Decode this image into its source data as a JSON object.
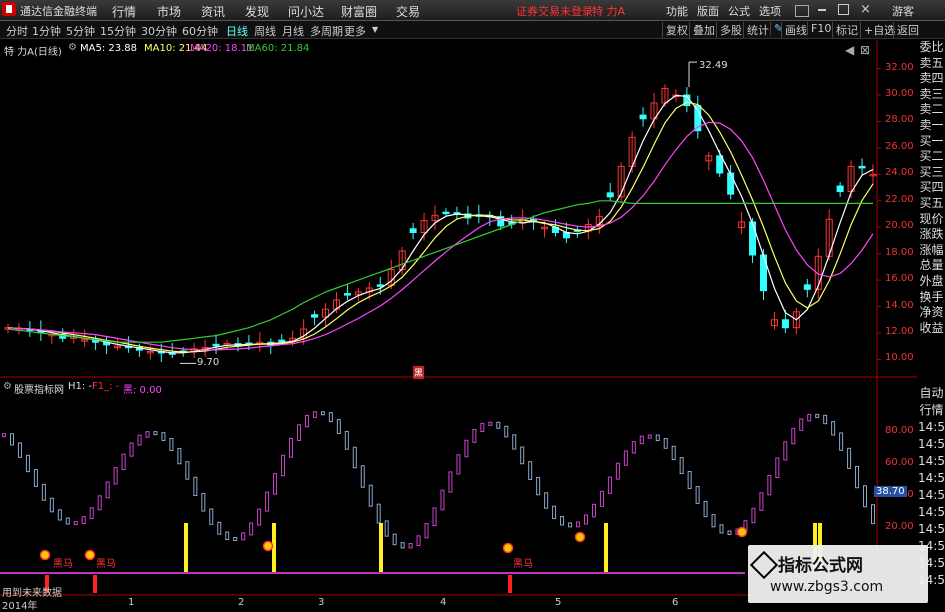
{
  "app": {
    "title": "通达信金融终端",
    "menu": [
      "行情",
      "市场",
      "资讯",
      "发现",
      "问小达",
      "财富圈",
      "交易"
    ],
    "status_text": "证券交易未登录",
    "stock_header": "特 力A",
    "right_menu": [
      "功能",
      "版面",
      "公式",
      "选项"
    ],
    "guest": "游客"
  },
  "toolbar": {
    "periods": [
      "分时",
      "1分钟",
      "5分钟",
      "15分钟",
      "30分钟",
      "60分钟",
      "日线",
      "周线",
      "月线",
      "多周期",
      "更多"
    ],
    "active_period": "日线",
    "right": [
      "复权",
      "叠加",
      "多股",
      "统计",
      "画线",
      "F10",
      "标记",
      "+自选",
      "返回"
    ]
  },
  "main_legend": {
    "stock": "特 力A(日线)",
    "ma5": "MA5: 23.88",
    "ma10": "MA10: 21.44",
    "ma20": "MA20: 18.11",
    "ma60": "MA60: 21.84",
    "colors": {
      "ma5": "#ffffff",
      "ma10": "#ffff66",
      "ma20": "#ff44ff",
      "ma60": "#33cc33"
    }
  },
  "indicator_legend": {
    "name": "股票指标网",
    "h1": "H1: -",
    "f1": "F1_: -",
    "black": "黑: 0.00"
  },
  "price_axis": [
    "32.00",
    "30.00",
    "28.00",
    "26.00",
    "24.00",
    "22.00",
    "20.00",
    "18.00",
    "16.00",
    "14.00",
    "12.00",
    "10.00"
  ],
  "indicator_axis": [
    "80.00",
    "60.00",
    "40.00",
    "20.00"
  ],
  "indicator_current": "38.70",
  "annotations": {
    "high": "32.49",
    "low": "9.70",
    "marker": "黑"
  },
  "horse_labels": [
    "黑马",
    "黑马",
    "黑马"
  ],
  "bottom_note": "用到未来数据",
  "date_axis": [
    "2014年",
    "1",
    "2",
    "3",
    "4",
    "5",
    "6"
  ],
  "side_panel": [
    "委比",
    "卖五",
    "卖四",
    "卖三",
    "卖二",
    "卖一",
    "买一",
    "买二",
    "买三",
    "买四",
    "买五",
    "现价",
    "涨跌",
    "涨幅",
    "总量",
    "外盘",
    "换手",
    "净资",
    "收益"
  ],
  "side_panel2": [
    "自动",
    "行情",
    "14:55",
    "14:55",
    "14:55",
    "14:55",
    "14:55",
    "14:55",
    "14:55",
    "14:55",
    "14:55",
    "14:55"
  ],
  "watermark": {
    "title": "指标公式网",
    "url": "www.zbgs3.com"
  },
  "chart_data": {
    "type": "candlestick",
    "ylim": [
      9.0,
      33.0
    ],
    "close": [
      12.4,
      12.3,
      12.2,
      12.0,
      11.9,
      11.6,
      11.7,
      11.5,
      11.3,
      11.1,
      11.0,
      10.9,
      10.7,
      10.6,
      10.5,
      10.4,
      10.6,
      10.8,
      10.9,
      11.1,
      11.2,
      11.0,
      11.2,
      11.3,
      11.1,
      11.4,
      11.6,
      12.3,
      13.2,
      13.8,
      14.5,
      14.9,
      15.1,
      15.4,
      15.6,
      16.8,
      18.2,
      19.6,
      20.5,
      20.9,
      21.1,
      21.0,
      20.7,
      20.9,
      20.8,
      20.1,
      20.3,
      20.6,
      20.4,
      20.0,
      19.6,
      19.2,
      19.7,
      20.2,
      20.8,
      22.3,
      24.6,
      26.8,
      28.2,
      29.4,
      30.5,
      30.0,
      29.2,
      27.3,
      25.4,
      24.1,
      22.5,
      20.4,
      17.9,
      15.2,
      13.0,
      12.4,
      13.6,
      15.3,
      17.8,
      20.6,
      22.7,
      24.6,
      24.5,
      24.0
    ],
    "ma60": [
      12.3,
      12.2,
      12.1,
      12.0,
      11.9,
      11.8,
      11.7,
      11.6,
      11.5,
      11.4,
      11.3,
      11.3,
      11.3,
      11.3,
      11.3,
      11.4,
      11.5,
      11.6,
      11.7,
      11.8,
      12.0,
      12.2,
      12.4,
      12.7,
      13.0,
      13.4,
      13.8,
      14.3,
      14.7,
      15.1,
      15.4,
      15.7,
      16.0,
      16.3,
      16.6,
      16.9,
      17.2,
      17.5,
      17.8,
      18.1,
      18.4,
      18.7,
      19.0,
      19.3,
      19.6,
      19.9,
      20.2,
      20.5,
      20.8,
      21.1,
      21.3,
      21.5,
      21.7,
      21.8,
      22.0,
      22.0,
      21.9,
      21.8,
      21.8,
      21.8
    ]
  }
}
